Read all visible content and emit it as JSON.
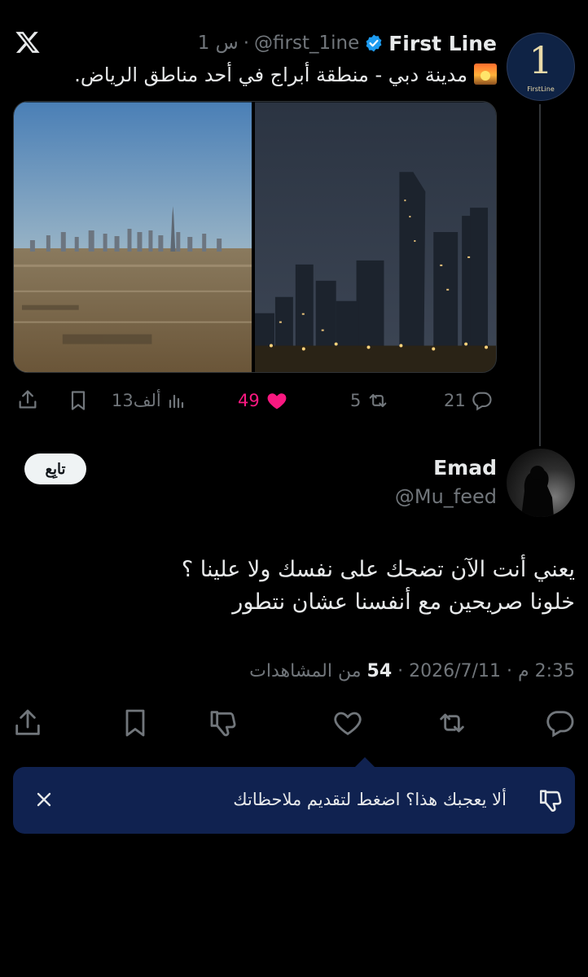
{
  "app": {
    "logo_icon": "x-logo-icon"
  },
  "quoted_tweet": {
    "author_name": "First Line",
    "avatar_text": "1",
    "avatar_caption": "FirstLine",
    "handle": "@first_1ine",
    "time": "1 س",
    "separator": "·",
    "text": "مدينة دبي - منطقة أبراج في أحد مناطق الرياض.",
    "emoji_icon": "sunset-emoji-icon",
    "metrics": {
      "replies": "21",
      "retweets": "5",
      "likes": "49",
      "views": "13ألف"
    },
    "liked": true
  },
  "main_tweet": {
    "author_name": "Emad",
    "handle": "@Mu_feed",
    "follow_label": "تابِع",
    "text_line1": "يعني أنت الآن تضحك على نفسك ولا علينا ؟",
    "text_line2": "خلونا صريحين مع أنفسنا عشان نتطور",
    "date": "2026/7/11",
    "time": "2:35 م",
    "views_count": "54",
    "views_label": "من المشاهدات",
    "separator": "·"
  },
  "feedback_banner": {
    "text": "ألا يعجبك هذا؟ اضغط لتقديم ملاحظاتك"
  },
  "colors": {
    "background": "#000000",
    "text": "#e7e9ea",
    "secondary": "#71767b",
    "like": "#f91880",
    "verified": "#1d9bf0",
    "banner": "#102250"
  }
}
